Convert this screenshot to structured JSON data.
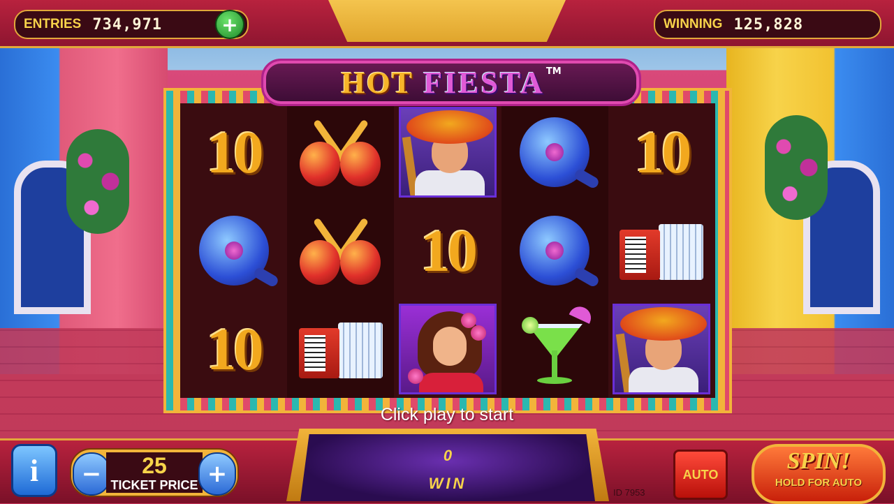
{
  "header": {
    "entries_label": "ENTRIES",
    "entries_value": "734,971",
    "winning_label": "WINNING",
    "winning_value": "125,828",
    "add_button_label": "+"
  },
  "title": {
    "word1": "HOT",
    "word2": "FIESTA",
    "trademark": "TM"
  },
  "reels": {
    "rows": [
      [
        "10",
        "maracas",
        "mariachi",
        "Q",
        "10"
      ],
      [
        "Q",
        "maracas",
        "10",
        "Q",
        "accordion"
      ],
      [
        "10",
        "accordion",
        "senorita",
        "margarita",
        "mariachi"
      ]
    ]
  },
  "prompt": "Click play to start",
  "controls": {
    "info_label": "i",
    "ticket_minus": "−",
    "ticket_plus": "+",
    "ticket_value": "25",
    "ticket_label": "TICKET PRICE",
    "win_value": "0",
    "win_label": "WIN",
    "auto_label": "AUTO",
    "spin_label": "SPIN!",
    "spin_sub": "HOLD FOR AUTO"
  },
  "footer": {
    "game_id": "ID 7953"
  },
  "colors": {
    "gold": "#f7d34a",
    "accent_red": "#b8223e",
    "reel_bg": "#3a0c10"
  }
}
